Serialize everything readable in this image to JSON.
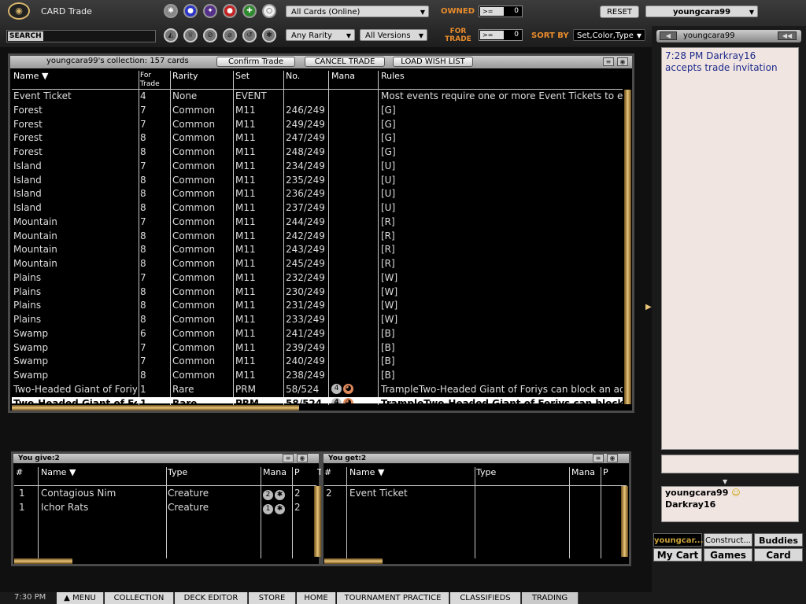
{
  "app": {
    "title": "CARD Trade",
    "logo": "◉"
  },
  "filters": {
    "color_orbs": [
      "✱",
      "●",
      "✦",
      "●",
      "✚",
      "○"
    ],
    "type_icons": [
      "◭",
      "♕",
      "⊘",
      "⌀",
      "↺",
      "✱"
    ],
    "search_label": "SEARCH",
    "cards_select": "All Cards (Online)",
    "rarity_select": "Any Rarity",
    "versions_select": "All Versions",
    "owned_label": "OWNED",
    "owned_op": ">=",
    "owned_val": "0",
    "for_trade_label": "FOR TRADE",
    "for_trade_op": ">=",
    "for_trade_val": "0",
    "sort_label": "SORT BY",
    "sort_select": "Set,Color,Type",
    "reset": "RESET",
    "user_select": "youngcara99"
  },
  "collection": {
    "title": "youngcara99's collection: 157 cards",
    "confirm": "Confirm Trade",
    "cancel": "CANCEL TRADE",
    "load": "LOAD WISH LIST",
    "columns": [
      "Name",
      "For Trade",
      "Rarity",
      "Set",
      "No.",
      "Mana",
      "Rules"
    ],
    "rows": [
      [
        "Event Ticket",
        "4",
        "None",
        "EVENT",
        "",
        "",
        "Most events require one or more Event Tickets to ent"
      ],
      [
        "Forest",
        "7",
        "Common",
        "M11",
        "246/249",
        "",
        "[G]"
      ],
      [
        "Forest",
        "7",
        "Common",
        "M11",
        "249/249",
        "",
        "[G]"
      ],
      [
        "Forest",
        "8",
        "Common",
        "M11",
        "247/249",
        "",
        "[G]"
      ],
      [
        "Forest",
        "8",
        "Common",
        "M11",
        "248/249",
        "",
        "[G]"
      ],
      [
        "Island",
        "7",
        "Common",
        "M11",
        "234/249",
        "",
        "[U]"
      ],
      [
        "Island",
        "8",
        "Common",
        "M11",
        "235/249",
        "",
        "[U]"
      ],
      [
        "Island",
        "8",
        "Common",
        "M11",
        "236/249",
        "",
        "[U]"
      ],
      [
        "Island",
        "8",
        "Common",
        "M11",
        "237/249",
        "",
        "[U]"
      ],
      [
        "Mountain",
        "7",
        "Common",
        "M11",
        "244/249",
        "",
        "[R]"
      ],
      [
        "Mountain",
        "8",
        "Common",
        "M11",
        "242/249",
        "",
        "[R]"
      ],
      [
        "Mountain",
        "8",
        "Common",
        "M11",
        "243/249",
        "",
        "[R]"
      ],
      [
        "Mountain",
        "8",
        "Common",
        "M11",
        "245/249",
        "",
        "[R]"
      ],
      [
        "Plains",
        "7",
        "Common",
        "M11",
        "232/249",
        "",
        "[W]"
      ],
      [
        "Plains",
        "8",
        "Common",
        "M11",
        "230/249",
        "",
        "[W]"
      ],
      [
        "Plains",
        "8",
        "Common",
        "M11",
        "231/249",
        "",
        "[W]"
      ],
      [
        "Plains",
        "8",
        "Common",
        "M11",
        "233/249",
        "",
        "[W]"
      ],
      [
        "Swamp",
        "6",
        "Common",
        "M11",
        "241/249",
        "",
        "[B]"
      ],
      [
        "Swamp",
        "7",
        "Common",
        "M11",
        "239/249",
        "",
        "[B]"
      ],
      [
        "Swamp",
        "7",
        "Common",
        "M11",
        "240/249",
        "",
        "[B]"
      ],
      [
        "Swamp",
        "8",
        "Common",
        "M11",
        "238/249",
        "",
        "[B]"
      ],
      [
        "Two-Headed Giant of Foriys",
        "1",
        "Rare",
        "PRM",
        "58/524",
        "4",
        "TrampleTwo-Headed Giant of Foriys can block an add"
      ],
      [
        "Two-Headed Giant of Foriys",
        "1",
        "Rare",
        "PRM",
        "58/524",
        "4",
        "TrampleTwo-Headed Giant of Foriys can block a"
      ]
    ]
  },
  "give": {
    "title": "You give:2",
    "columns": [
      "#",
      "Name",
      "Type",
      "Mana",
      "P",
      "T"
    ],
    "rows": [
      [
        "1",
        "Contagious Nim",
        "Creature",
        "2",
        "2"
      ],
      [
        "1",
        "Ichor Rats",
        "Creature",
        "1",
        "2"
      ]
    ]
  },
  "get": {
    "title": "You get:2",
    "columns": [
      "#",
      "Name",
      "Type",
      "Mana",
      "P"
    ],
    "rows": [
      [
        "2",
        "Event Ticket",
        "",
        "",
        ""
      ]
    ]
  },
  "chat": {
    "header": "youngcara99",
    "message": "7:28 PM Darkray16 accepts trade invitation",
    "participants": [
      "youngcara99",
      "Darkray16"
    ],
    "smiley": "☺"
  },
  "tabs": {
    "row1": [
      "youngcar...",
      "Construct...",
      "Buddies"
    ],
    "row2": [
      "My Cart",
      "Games",
      "Card"
    ]
  },
  "bottombar": {
    "clock": "7:30 PM",
    "items": [
      "MENU",
      "COLLECTION",
      "DECK EDITOR",
      "STORE",
      "HOME",
      "TOURNAMENT PRACTICE",
      "CLASSIFIEDS",
      "TRADING"
    ]
  }
}
